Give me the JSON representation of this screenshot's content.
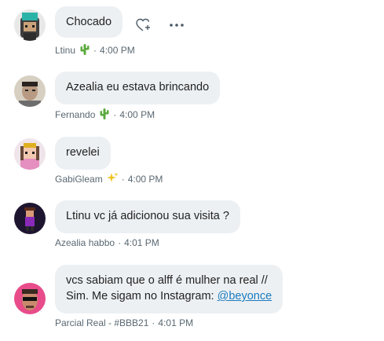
{
  "messages": [
    {
      "text": "Chocado",
      "author": "Ltinu",
      "time": "4:00 PM",
      "badge_icon": "cactus-icon",
      "avatar_color": "#3d3d3d"
    },
    {
      "text": "Azealia eu estava brincando",
      "author": "Fernando",
      "time": "4:00 PM",
      "badge_icon": "cactus-icon",
      "avatar_color": "#9a8f7a"
    },
    {
      "text": "revelei",
      "author": "GabiGleam",
      "time": "4:00 PM",
      "badge_icon": "sparkles-icon",
      "avatar_color": "#d8b0c8"
    },
    {
      "text": "Ltinu vc já adicionou sua visita ?",
      "author": "Azealia habbo",
      "time": "4:01 PM",
      "avatar_color": "#1e1530"
    },
    {
      "line1": "vcs sabiam que o alff é  mulher na real //",
      "line2_prefix": "Sim. Me sigam no Instagram: ",
      "line2_link": "@beyonce",
      "author": "Parcial Real - #BBB21",
      "time": "4:01 PM",
      "avatar_color": "#e84c8a"
    }
  ],
  "separator": "·",
  "actions": [
    "add-reaction-icon",
    "more-options-icon"
  ]
}
